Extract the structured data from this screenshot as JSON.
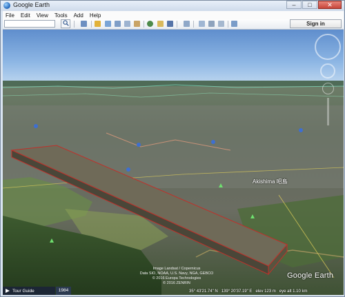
{
  "window": {
    "title": "Google Earth"
  },
  "menu": [
    "File",
    "Edit",
    "View",
    "Tools",
    "Add",
    "Help"
  ],
  "toolbar": {
    "search_value": "",
    "sign_in_label": "Sign in"
  },
  "map": {
    "place_label": "Akishima 昭島",
    "credits": [
      "Image Landsat / Copernicus",
      "Data SIO, NOAA, U.S. Navy, NGA, GEBCO",
      "© 2016 Europa Technologies",
      "© 2016 ZENRIN"
    ],
    "logo_text": "Google Earth"
  },
  "tour": {
    "label": "Tour Guide",
    "year": "1984"
  },
  "status": {
    "lat": "35° 43'21.74\" N",
    "lon": "139° 20'37.19\" E",
    "elev": "elev  123 m",
    "eye_alt": "eye alt   1.10 km"
  }
}
